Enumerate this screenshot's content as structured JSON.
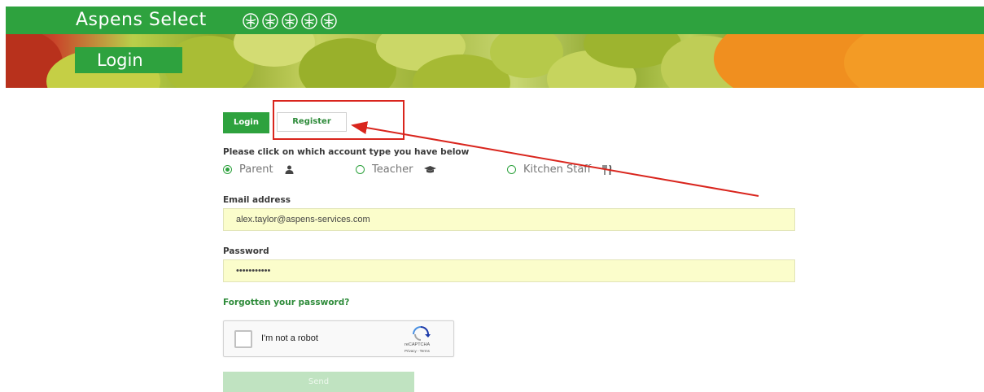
{
  "header": {
    "brand": "Aspens Select",
    "logo_icon": "aspens-leaf-logo-icon"
  },
  "banner": {
    "page_label": "Login"
  },
  "tabs": [
    {
      "label": "Login",
      "active": true
    },
    {
      "label": "Register",
      "active": false
    }
  ],
  "form": {
    "instruction": "Please click on which account type you have below",
    "account_types": [
      {
        "label": "Parent",
        "selected": true,
        "icon": "user-icon"
      },
      {
        "label": "Teacher",
        "selected": false,
        "icon": "graduation-cap-icon"
      },
      {
        "label": "Kitchen Staff",
        "selected": false,
        "icon": "cutlery-icon"
      }
    ],
    "email_label": "Email address",
    "email_value": "alex.taylor@aspens-services.com",
    "password_label": "Password",
    "password_value": "•••••••••••",
    "forgot_link": "Forgotten your password?",
    "send_label": "Send"
  },
  "captcha": {
    "label": "I'm not a robot",
    "brand": "reCAPTCHA",
    "links": "Privacy - Terms"
  },
  "colors": {
    "brand_green": "#2ea23e",
    "input_bg": "#fbfdcb",
    "annotation_red": "#d9251d"
  }
}
